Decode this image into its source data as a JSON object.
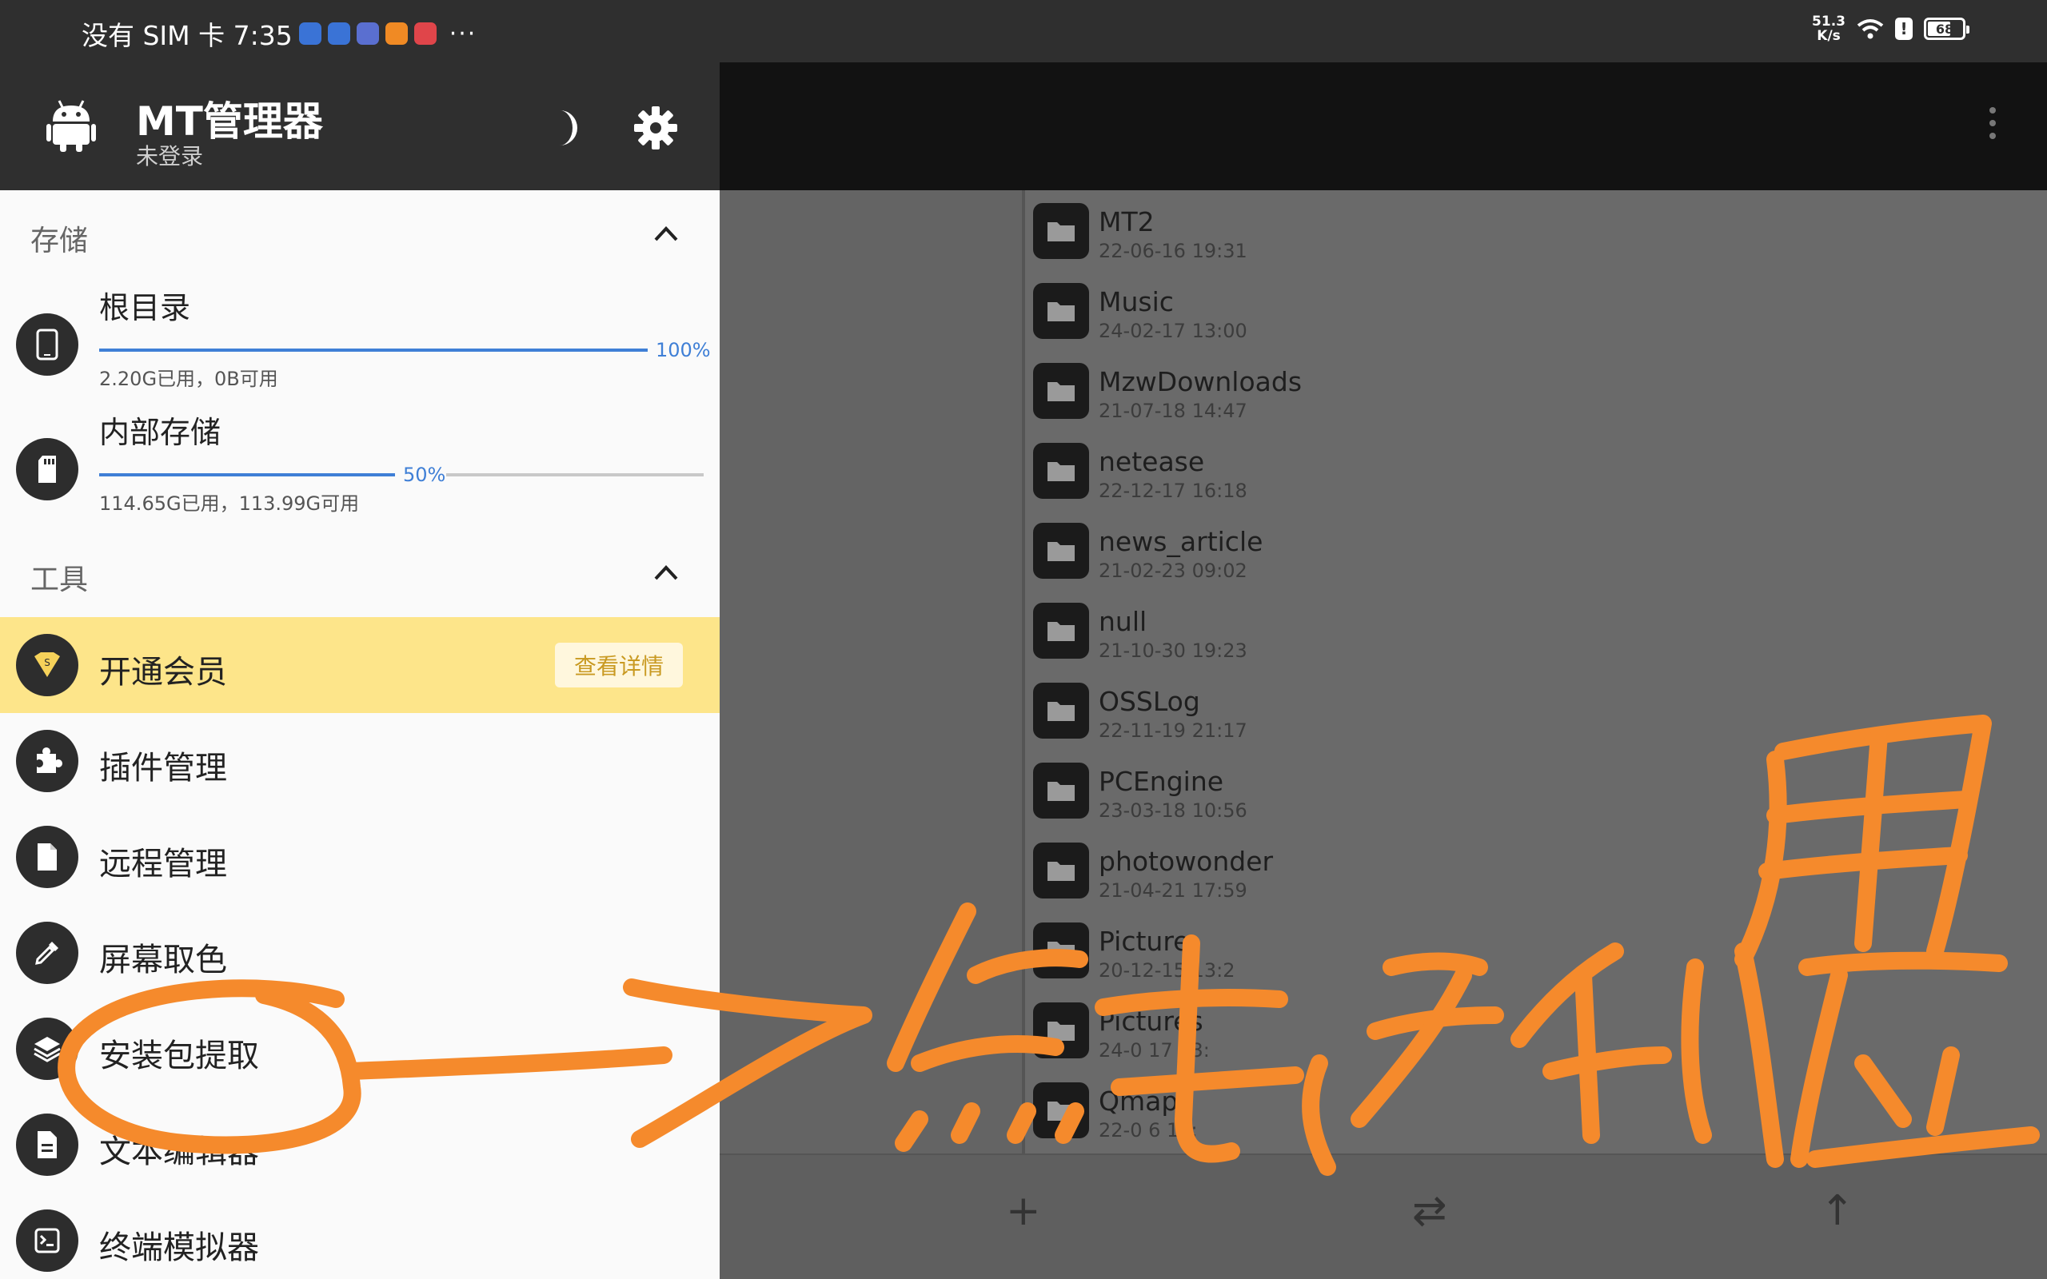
{
  "status_bar": {
    "carrier_time": "没有 SIM 卡 7:35",
    "more": "···",
    "net_speed_value": "51.3",
    "net_speed_unit": "K/s",
    "battery": "68",
    "alert": "!",
    "app_icon_colors": [
      "#3a73d6",
      "#3a73d6",
      "#5a6fd0",
      "#f08a24",
      "#e0454a"
    ]
  },
  "drawer": {
    "app_name": "MT管理器",
    "login_status": "未登录",
    "storage_section": "存储",
    "storage": [
      {
        "name": "根目录",
        "percent": 100,
        "percent_label": "100%",
        "info": "2.20G已用，0B可用"
      },
      {
        "name": "内部存储",
        "percent": 50,
        "percent_label": "50%",
        "info": "114.65G已用，113.99G可用"
      }
    ],
    "tools_section": "工具",
    "vip": {
      "label": "开通会员",
      "button": "查看详情"
    },
    "tools": [
      {
        "label": "插件管理",
        "icon": "puzzle-icon"
      },
      {
        "label": "远程管理",
        "icon": "file-icon"
      },
      {
        "label": "屏幕取色",
        "icon": "eyedropper-icon"
      },
      {
        "label": "安装包提取",
        "icon": "layers-icon"
      },
      {
        "label": "文本编辑器",
        "icon": "document-icon"
      },
      {
        "label": "终端模拟器",
        "icon": "terminal-icon"
      }
    ]
  },
  "files": [
    {
      "name": "MT2",
      "date": "22-06-16 19:31"
    },
    {
      "name": "Music",
      "date": "24-02-17 13:00"
    },
    {
      "name": "MzwDownloads",
      "date": "21-07-18 14:47"
    },
    {
      "name": "netease",
      "date": "22-12-17 16:18"
    },
    {
      "name": "news_article",
      "date": "21-02-23 09:02"
    },
    {
      "name": "null",
      "date": "21-10-30 19:23"
    },
    {
      "name": "OSSLog",
      "date": "22-11-19 21:17"
    },
    {
      "name": "PCEngine",
      "date": "23-03-18 10:56"
    },
    {
      "name": "photowonder",
      "date": "21-04-21 17:59"
    },
    {
      "name": "Picture",
      "date": "20-12-15 13:2"
    },
    {
      "name": "Pictures",
      "date": "24-0 17 13:"
    },
    {
      "name": "Qmap",
      "date": "22-0 6 19:"
    }
  ],
  "bottom_bar": {
    "add": "+",
    "swap": "⇄",
    "up": "↑"
  },
  "annotation": {
    "color": "#f58a2c"
  }
}
